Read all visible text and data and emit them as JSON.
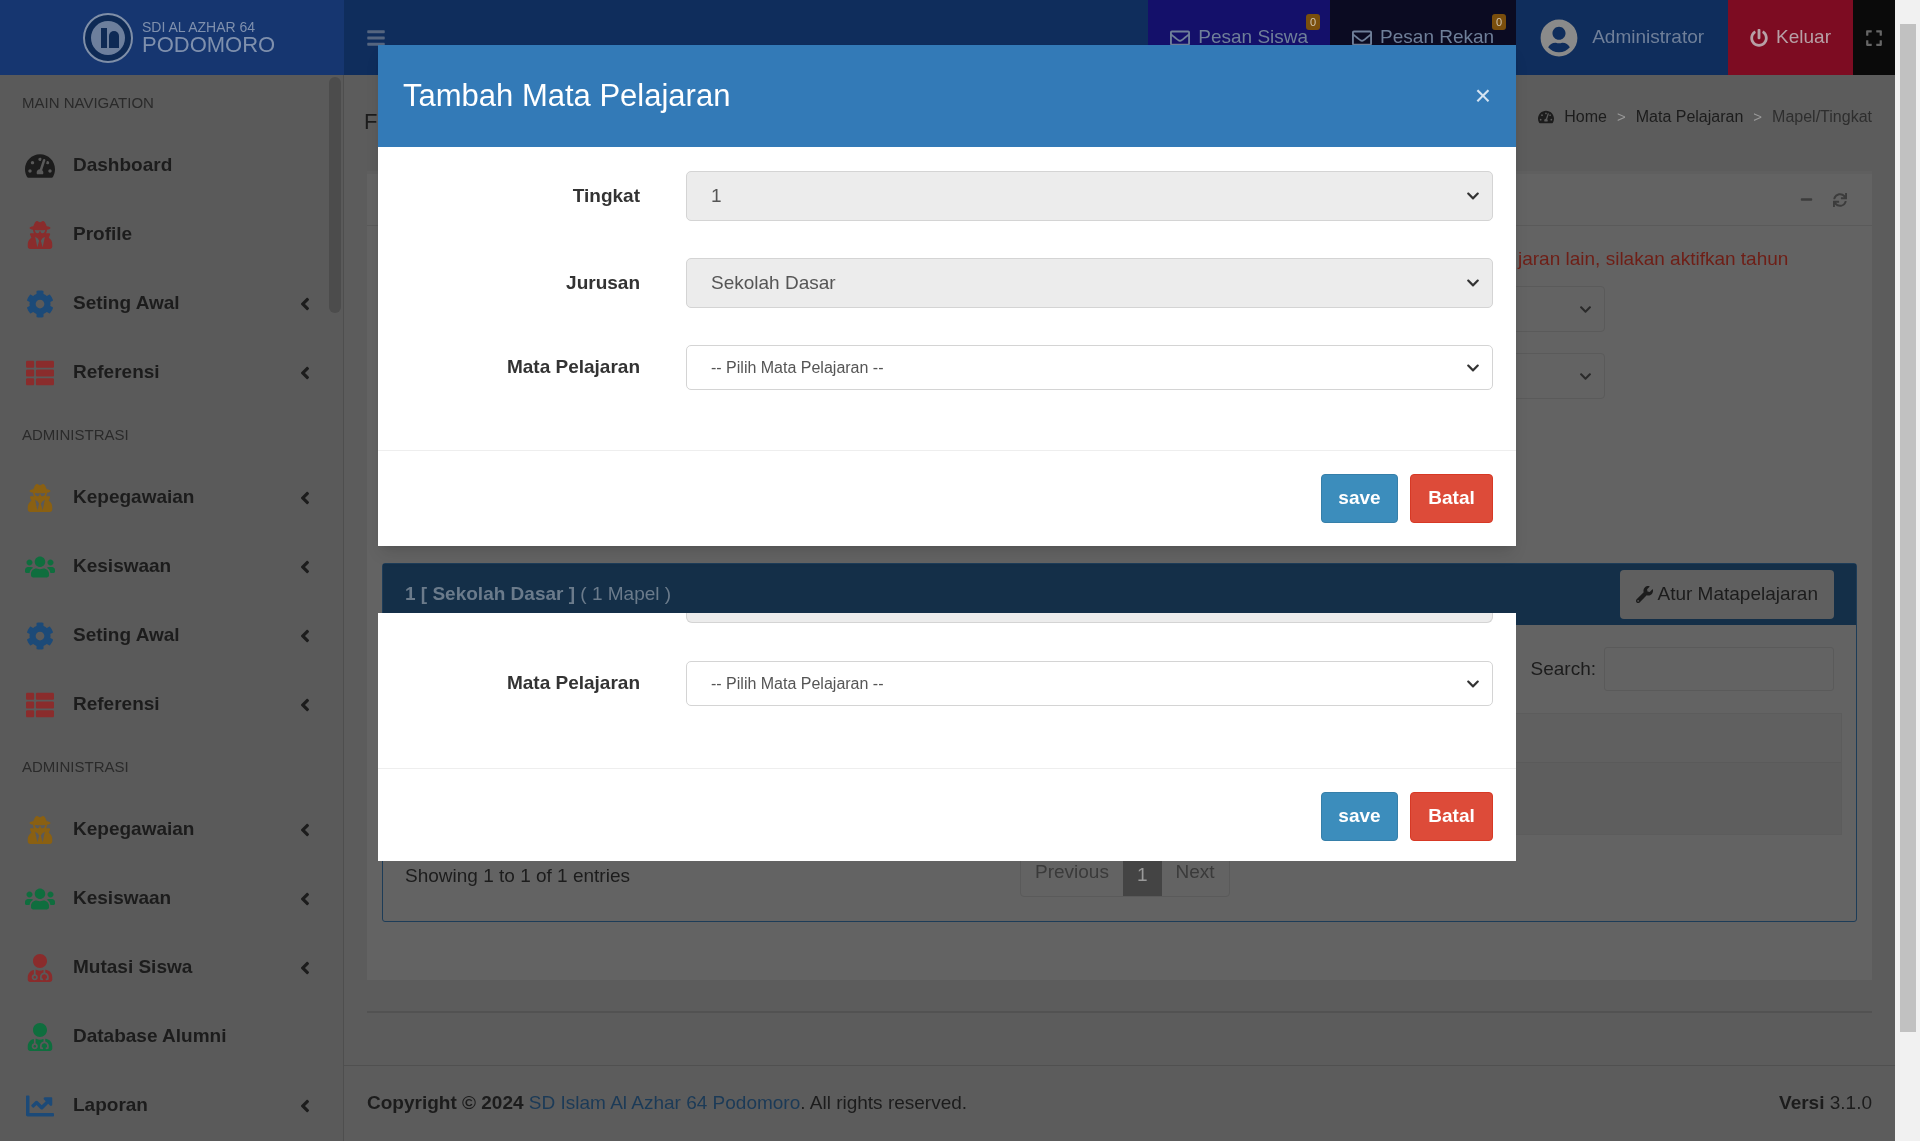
{
  "header": {
    "logo_line1": "SDI AL AZHAR 64",
    "logo_line2": "PODOMORO",
    "nav": [
      {
        "kind": "message",
        "label": "Pesan Siswa",
        "badge": "0",
        "color": "#14106a"
      },
      {
        "kind": "message",
        "label": "Pesan Rekan",
        "badge": "0",
        "color": "#0b0b22"
      },
      {
        "kind": "user",
        "label": "Administrator",
        "color": "#0f2d5c"
      },
      {
        "kind": "logout",
        "label": "Keluar",
        "color": "#7d0c22"
      },
      {
        "kind": "fullscreen",
        "color": "#0a0a0a"
      }
    ]
  },
  "sidebar": {
    "items": [
      {
        "kind": "header",
        "label": "MAIN NAVIGATION"
      },
      {
        "kind": "link",
        "label": "Dashboard",
        "color": "#1c1c1c",
        "collapsible": false
      },
      {
        "kind": "link",
        "label": "Profile",
        "color": "#8a2c2c",
        "collapsible": false
      },
      {
        "kind": "link",
        "label": "Seting Awal",
        "color": "#1c4a78",
        "collapsible": true
      },
      {
        "kind": "link",
        "label": "Referensi",
        "color": "#8a2c2c",
        "collapsible": true
      },
      {
        "kind": "header",
        "label": "ADMINISTRASI"
      },
      {
        "kind": "link",
        "label": "Kepegawaian",
        "color": "#8a6012",
        "collapsible": true
      },
      {
        "kind": "link",
        "label": "Kesiswaan",
        "color": "#0f6e3e",
        "collapsible": true
      },
      {
        "kind": "link",
        "label": "Seting Awal",
        "color": "#1c4a78",
        "collapsible": true
      },
      {
        "kind": "link",
        "label": "Referensi",
        "color": "#8a2c2c",
        "collapsible": true
      },
      {
        "kind": "header",
        "label": "ADMINISTRASI"
      },
      {
        "kind": "link",
        "label": "Kepegawaian",
        "color": "#8a6012",
        "collapsible": true
      },
      {
        "kind": "link",
        "label": "Kesiswaan",
        "color": "#0f6e3e",
        "collapsible": true
      },
      {
        "kind": "link",
        "label": "Mutasi Siswa",
        "color": "#8a2c2c",
        "collapsible": true
      },
      {
        "kind": "link",
        "label": "Database Alumni",
        "color": "#0f6e3e",
        "collapsible": false
      },
      {
        "kind": "link",
        "label": "Laporan",
        "color": "#1c4a78",
        "collapsible": true
      }
    ]
  },
  "content": {
    "title": "F",
    "breadcrumb": [
      "Home",
      "Mata Pelajaran",
      "Mapel/Tingkat"
    ],
    "separator": ">",
    "notice": "jaran lain, silakan aktifkan tahun",
    "panel": {
      "title": "1 [ Sekolah Dasar ]",
      "count": "( 1 Mapel )",
      "button": "Atur Matapelajaran",
      "search_label": "Search:",
      "info": "Showing 1 to 1 of 1 entries",
      "pagination": [
        {
          "label": "Previous",
          "selected": false
        },
        {
          "label": "1",
          "selected": true
        },
        {
          "label": "Next",
          "selected": false
        }
      ]
    }
  },
  "modals": [
    {
      "title": "Tambah Mata Pelajaran",
      "close": "×",
      "fields": [
        {
          "kind": "select",
          "label": "Tingkat",
          "value": "1",
          "disabled": true
        },
        {
          "kind": "select",
          "label": "Jurusan",
          "value": "Sekolah Dasar",
          "disabled": true
        },
        {
          "kind": "select",
          "label": "Mata Pelajaran",
          "value": "-- Pilih Mata Pelajaran --",
          "disabled": false
        }
      ],
      "buttons": [
        {
          "kind": "primary",
          "label": "save"
        },
        {
          "kind": "danger",
          "label": "Batal"
        }
      ]
    },
    {
      "fields": [
        {
          "kind": "cut",
          "disabled": true
        },
        {
          "kind": "select",
          "label": "Mata Pelajaran",
          "value": "-- Pilih Mata Pelajaran --",
          "disabled": false
        }
      ],
      "buttons": [
        {
          "kind": "primary",
          "label": "save"
        },
        {
          "kind": "danger",
          "label": "Batal"
        }
      ]
    }
  ],
  "footer": {
    "copyright": "**Copyright © 2024** ",
    "link": "SD Islam Al Azhar 64 Podomoro",
    "rest": ". All rights reserved.",
    "version": "**Versi** 3.1.0"
  }
}
